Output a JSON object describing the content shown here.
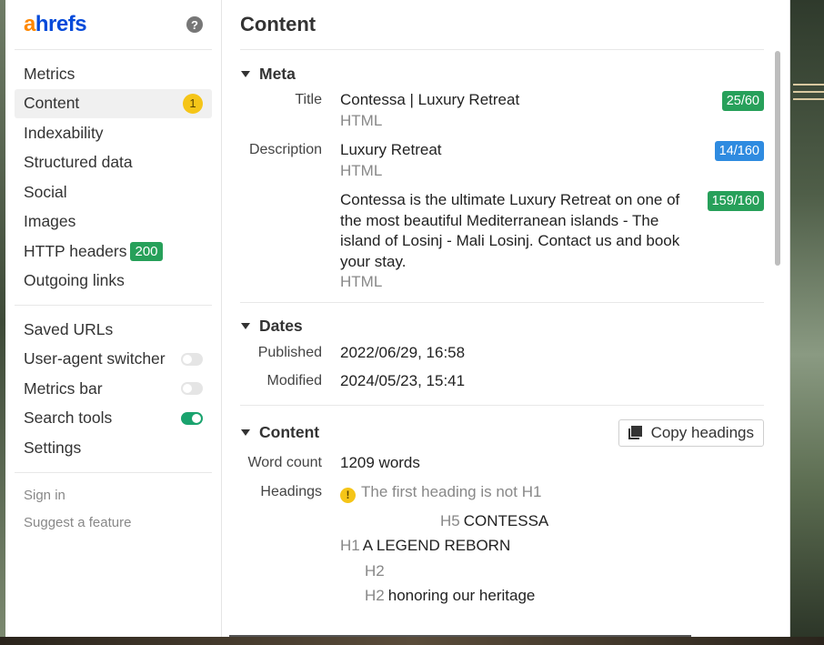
{
  "brand": {
    "logo_a": "a",
    "logo_rest": "hrefs",
    "help": "?"
  },
  "sidebar": {
    "items": [
      {
        "label": "Metrics"
      },
      {
        "label": "Content",
        "badge": "1"
      },
      {
        "label": "Indexability"
      },
      {
        "label": "Structured data"
      },
      {
        "label": "Social"
      },
      {
        "label": "Images"
      },
      {
        "label": "HTTP headers",
        "badge": "200"
      },
      {
        "label": "Outgoing links"
      }
    ],
    "tools": [
      {
        "label": "Saved URLs"
      },
      {
        "label": "User-agent switcher",
        "toggle": false
      },
      {
        "label": "Metrics bar",
        "toggle": false
      },
      {
        "label": "Search tools",
        "toggle": true
      },
      {
        "label": "Settings"
      }
    ],
    "links": [
      "Sign in",
      "Suggest a feature"
    ]
  },
  "main": {
    "title": "Content",
    "meta": {
      "heading": "Meta",
      "title_key": "Title",
      "title_val": "Contessa | Luxury Retreat",
      "title_sub": "HTML",
      "title_count": "25/60",
      "desc_key": "Description",
      "desc_val": "Luxury Retreat",
      "desc_sub": "HTML",
      "desc_count": "14/160",
      "desc2_val": "Contessa is the ultimate Luxury Retreat on one of the most beautiful Mediterranean islands - The island of Losinj - Mali Losinj. Contact us and book your stay.",
      "desc2_sub": "HTML",
      "desc2_count": "159/160"
    },
    "dates": {
      "heading": "Dates",
      "published_key": "Published",
      "published_val": "2022/06/29, 16:58",
      "modified_key": "Modified",
      "modified_val": "2024/05/23, 15:41"
    },
    "content": {
      "heading": "Content",
      "copy_label": "Copy headings",
      "wordcount_key": "Word count",
      "wordcount_val": "1209 words",
      "headings_key": "Headings",
      "warning": "The first heading is not H1",
      "headings": [
        {
          "level": "H5",
          "text": "CONTESSA"
        },
        {
          "level": "H1",
          "text": "A LEGEND REBORN"
        },
        {
          "level": "H2",
          "text": ""
        },
        {
          "level": "H2",
          "text": "honoring our heritage"
        }
      ]
    }
  },
  "colors": {
    "green": "#27a05a",
    "blue": "#2f8be0",
    "yellow": "#f5c518",
    "brand_orange": "#ff8800",
    "brand_blue": "#054ada"
  }
}
